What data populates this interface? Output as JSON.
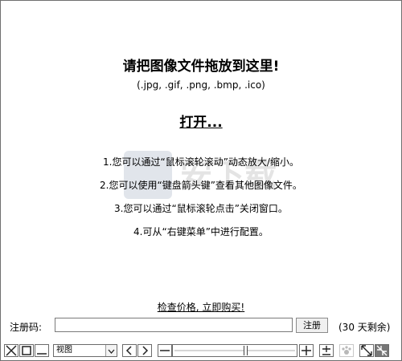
{
  "main": {
    "title": "请把图像文件拖放到这里!",
    "formats": "(.jpg, .gif, .png, .bmp, .ico)",
    "open_label": "打开...",
    "tips": [
      "1.您可以通过“鼠标滚轮滚动”动态放大/缩小。",
      "2.您可以使用“键盘箭头键”查看其他图像文件。",
      "3.您可以通过“鼠标滚轮点击”关闭窗口。",
      "4.可从“右键菜单”中进行配置。"
    ],
    "buy_label": "检查价格, 立即购买!"
  },
  "registration": {
    "label": "注册码:",
    "value": "",
    "button": "注册",
    "days_left": "(30 天剩余)"
  },
  "toolbar": {
    "view_selected": "视图",
    "zoom_level": 0.58,
    "icons": [
      "close-icon",
      "maximize-icon",
      "minimize-icon",
      "chevron-down-icon",
      "previous-icon",
      "next-icon",
      "zoom-out-icon",
      "zoom-in-icon",
      "fit-toggle-icon",
      "paw-icon",
      "expand-icon",
      "shrink-icon"
    ]
  },
  "colors": {
    "border": "#6b6b6b",
    "background": "#ffffff",
    "text": "#000000"
  }
}
